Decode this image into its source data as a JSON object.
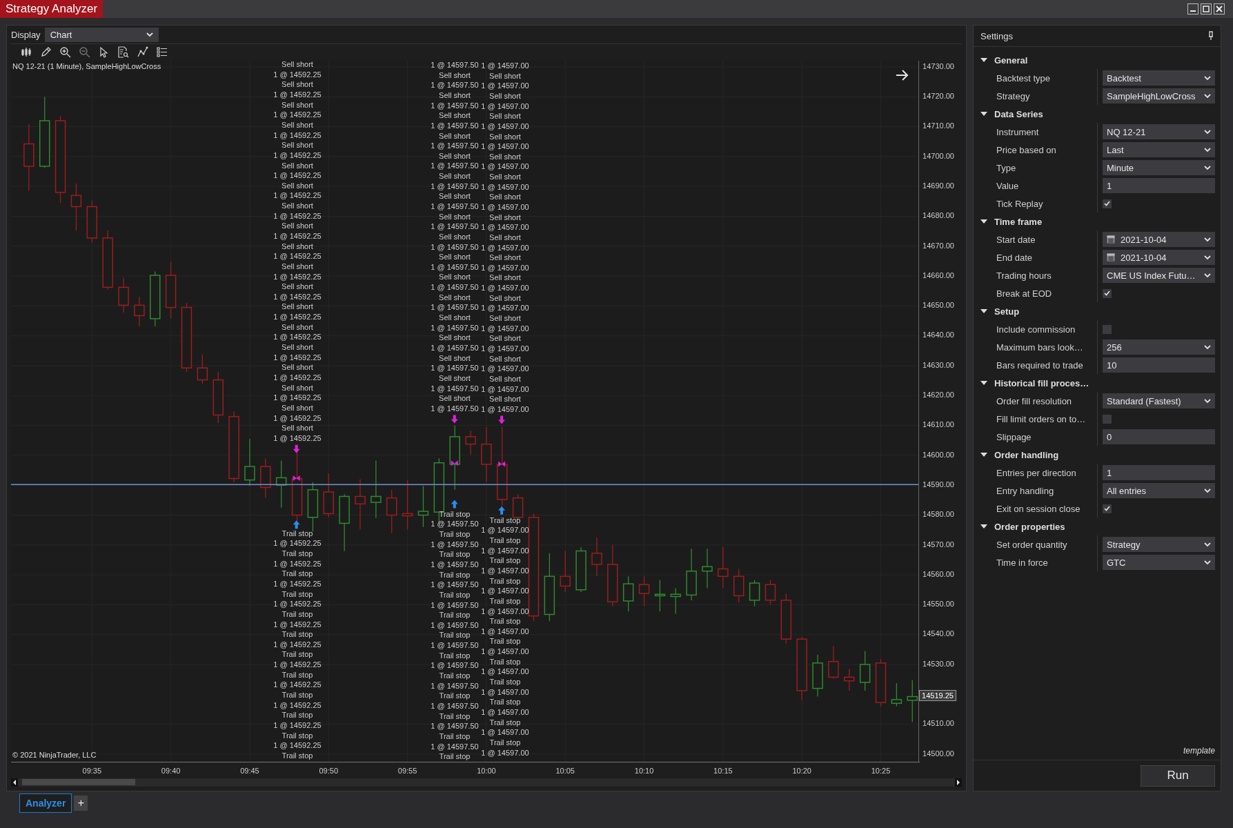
{
  "window": {
    "title": "Strategy Analyzer"
  },
  "display": {
    "label": "Display",
    "value": "Chart"
  },
  "chart": {
    "title": "NQ 12-21 (1 Minute), SampleHighLowCross",
    "copyright": "© 2021 NinjaTrader, LLC",
    "chart_data": {
      "type": "candlestick",
      "x": [
        571,
        572,
        573,
        574,
        575,
        576,
        577,
        578,
        579,
        580,
        581,
        582,
        583,
        584,
        585,
        586,
        587,
        588,
        589,
        590,
        591,
        592,
        593,
        594,
        595,
        596,
        597,
        598,
        599,
        600,
        601,
        602,
        603,
        604,
        605,
        606,
        607,
        608,
        609,
        610,
        611,
        612,
        613,
        614,
        615,
        616,
        617,
        618,
        619,
        620,
        621,
        622,
        623,
        624,
        625,
        626,
        627
      ],
      "xlim": [
        569.87,
        627.47
      ],
      "ylim": [
        14497.44,
        14732.08
      ],
      "grid": true,
      "ref_lines": [
        {
          "axis": "y",
          "value": 14590.25
        }
      ],
      "ohlc": [
        [
          14704.25,
          14710.75,
          14688.5,
          14696.75
        ],
        [
          14696.75,
          14720,
          14696.25,
          14712
        ],
        [
          14712,
          14713.5,
          14684.5,
          14688
        ],
        [
          14687,
          14691,
          14675.25,
          14683.25
        ],
        [
          14683.25,
          14685.25,
          14671.25,
          14672.75
        ],
        [
          14672.75,
          14675.25,
          14655.5,
          14656.25
        ],
        [
          14656.25,
          14659.5,
          14647.75,
          14650.25
        ],
        [
          14650.25,
          14653,
          14643.25,
          14646.75
        ],
        [
          14645.75,
          14661.5,
          14643.25,
          14660.25
        ],
        [
          14660.25,
          14664.75,
          14645.75,
          14649.5
        ],
        [
          14649.5,
          14651,
          14628,
          14629.25
        ],
        [
          14629.25,
          14633.75,
          14624,
          14625.25
        ],
        [
          14625.25,
          14628,
          14610.75,
          14613.5
        ],
        [
          14613,
          14614.75,
          14591,
          14592.25
        ],
        [
          14591.75,
          14605.5,
          14589.75,
          14596.25
        ],
        [
          14596.25,
          14599,
          14585.75,
          14589.25
        ],
        [
          14590,
          14598.25,
          14582.5,
          14592.5
        ],
        [
          14592.25,
          14601,
          14578,
          14580
        ],
        [
          14579.25,
          14591,
          14574.5,
          14588.5
        ],
        [
          14587.75,
          14594,
          14579.25,
          14580.5
        ],
        [
          14577.25,
          14587,
          14568,
          14586.25
        ],
        [
          14586.25,
          14592,
          14575.25,
          14583.75
        ],
        [
          14584.25,
          14598.25,
          14579,
          14586.25
        ],
        [
          14585.75,
          14588.5,
          14574,
          14580
        ],
        [
          14580.5,
          14591.75,
          14575.25,
          14579.75
        ],
        [
          14580,
          14589.75,
          14576,
          14581.25
        ],
        [
          14581,
          14599,
          14577.25,
          14597.5
        ],
        [
          14597,
          14610,
          14588.5,
          14606.25
        ],
        [
          14606.25,
          14608.25,
          14600.25,
          14603.75
        ],
        [
          14603.75,
          14609.5,
          14591,
          14597
        ],
        [
          14597,
          14609.5,
          14583.25,
          14585.25
        ],
        [
          14585.75,
          14587,
          14578.5,
          14579.25
        ],
        [
          14579.25,
          14580.5,
          14544.5,
          14546.25
        ],
        [
          14546.75,
          14567.25,
          14544.5,
          14559.5
        ],
        [
          14559.5,
          14568,
          14554.25,
          14556.25
        ],
        [
          14555,
          14569.25,
          14554.25,
          14568
        ],
        [
          14567.25,
          14572.5,
          14559.5,
          14563.5
        ],
        [
          14563.5,
          14570,
          14549.5,
          14551
        ],
        [
          14551.25,
          14559.5,
          14547.75,
          14557
        ],
        [
          14556.75,
          14559.5,
          14549.5,
          14553.75
        ],
        [
          14553,
          14558.25,
          14547.75,
          14553.5
        ],
        [
          14552.75,
          14555.5,
          14547,
          14553.5
        ],
        [
          14553.25,
          14568.75,
          14551.5,
          14561.25
        ],
        [
          14561.25,
          14568.75,
          14555.5,
          14562.75
        ],
        [
          14562,
          14569.25,
          14555.5,
          14559.5
        ],
        [
          14559.5,
          14562,
          14550.75,
          14553
        ],
        [
          14551.5,
          14558.25,
          14549.5,
          14557.25
        ],
        [
          14556.75,
          14558.25,
          14550,
          14551.5
        ],
        [
          14551.5,
          14553.75,
          14537,
          14538.5
        ],
        [
          14538.5,
          14539.25,
          14518,
          14521.25
        ],
        [
          14522,
          14533.25,
          14519.25,
          14530.5
        ],
        [
          14531,
          14536.25,
          14525.25,
          14525.75
        ],
        [
          14525.75,
          14528.5,
          14521.25,
          14524.5
        ],
        [
          14524,
          14534.5,
          14521.25,
          14530
        ],
        [
          14530.5,
          14531.75,
          14516,
          14517.25
        ],
        [
          14517,
          14523.75,
          14516,
          14518.25
        ],
        [
          14518,
          14524.75,
          14510.75,
          14519.25
        ]
      ],
      "xticks": [
        {
          "value": 575,
          "label": "09:35"
        },
        {
          "value": 580,
          "label": "09:40"
        },
        {
          "value": 585,
          "label": "09:45"
        },
        {
          "value": 590,
          "label": "09:50"
        },
        {
          "value": 595,
          "label": "09:55"
        },
        {
          "value": 600,
          "label": "10:00"
        },
        {
          "value": 605,
          "label": "10:05"
        },
        {
          "value": 610,
          "label": "10:10"
        },
        {
          "value": 615,
          "label": "10:15"
        },
        {
          "value": 620,
          "label": "10:20"
        },
        {
          "value": 625,
          "label": "10:25"
        }
      ],
      "yticks": [
        {
          "value": 14730,
          "label": "14730.00"
        },
        {
          "value": 14720,
          "label": "14720.00"
        },
        {
          "value": 14710,
          "label": "14710.00"
        },
        {
          "value": 14700,
          "label": "14700.00"
        },
        {
          "value": 14690,
          "label": "14690.00"
        },
        {
          "value": 14680,
          "label": "14680.00"
        },
        {
          "value": 14670,
          "label": "14670.00"
        },
        {
          "value": 14660,
          "label": "14660.00"
        },
        {
          "value": 14650,
          "label": "14650.00"
        },
        {
          "value": 14640,
          "label": "14640.00"
        },
        {
          "value": 14630,
          "label": "14630.00"
        },
        {
          "value": 14620,
          "label": "14620.00"
        },
        {
          "value": 14610,
          "label": "14610.00"
        },
        {
          "value": 14600,
          "label": "14600.00"
        },
        {
          "value": 14590,
          "label": "14590.00"
        },
        {
          "value": 14580,
          "label": "14580.00"
        },
        {
          "value": 14570,
          "label": "14570.00"
        },
        {
          "value": 14560,
          "label": "14560.00"
        },
        {
          "value": 14550,
          "label": "14550.00"
        },
        {
          "value": 14540,
          "label": "14540.00"
        },
        {
          "value": 14530,
          "label": "14530.00"
        },
        {
          "value": 14510,
          "label": "14510.00"
        },
        {
          "value": 14500,
          "label": "14500.00"
        }
      ]
    },
    "last_price": "14519.25",
    "annotations": [
      {
        "kind": "entry",
        "lines": [
          "Sell short",
          "1 @ 14592.25",
          "Sell short",
          "1 @ 14592.25",
          "Sell short",
          "1 @ 14592.25",
          "Sell short",
          "1 @ 14592.25",
          "Sell short",
          "1 @ 14592.25",
          "Sell short",
          "1 @ 14592.25",
          "Sell short",
          "1 @ 14592.25",
          "Sell short",
          "1 @ 14592.25",
          "Sell short",
          "1 @ 14592.25",
          "Sell short",
          "1 @ 14592.25",
          "Sell short",
          "1 @ 14592.25",
          "Sell short",
          "1 @ 14592.25",
          "Sell short",
          "1 @ 14592.25",
          "Sell short",
          "1 @ 14592.25",
          "Sell short",
          "1 @ 14592.25",
          "Sell short",
          "1 @ 14592.25",
          "Sell short",
          "1 @ 14592.25",
          "Sell short",
          "1 @ 14592.25",
          "Sell short",
          "1 @ 14592.25"
        ]
      },
      {
        "kind": "entry",
        "lines": [
          "1 @ 14597.50",
          "Sell short",
          "1 @ 14597.50",
          "Sell short",
          "1 @ 14597.50",
          "Sell short",
          "1 @ 14597.50",
          "Sell short",
          "1 @ 14597.50",
          "Sell short",
          "1 @ 14597.50",
          "Sell short",
          "1 @ 14597.50",
          "Sell short",
          "1 @ 14597.50",
          "Sell short",
          "1 @ 14597.50",
          "Sell short",
          "1 @ 14597.50",
          "Sell short",
          "1 @ 14597.50",
          "Sell short",
          "1 @ 14597.50",
          "Sell short",
          "1 @ 14597.50",
          "Sell short",
          "1 @ 14597.50",
          "Sell short",
          "1 @ 14597.50",
          "Sell short",
          "1 @ 14597.50",
          "Sell short",
          "1 @ 14597.50",
          "Sell short",
          "1 @ 14597.50"
        ]
      },
      {
        "kind": "entry",
        "lines": [
          "1 @ 14597.00",
          "Sell short",
          "1 @ 14597.00",
          "Sell short",
          "1 @ 14597.00",
          "Sell short",
          "1 @ 14597.00",
          "Sell short",
          "1 @ 14597.00",
          "Sell short",
          "1 @ 14597.00",
          "Sell short",
          "1 @ 14597.00",
          "Sell short",
          "1 @ 14597.00",
          "Sell short",
          "1 @ 14597.00",
          "Sell short",
          "1 @ 14597.00",
          "Sell short",
          "1 @ 14597.00",
          "Sell short",
          "1 @ 14597.00",
          "Sell short",
          "1 @ 14597.00",
          "Sell short",
          "1 @ 14597.00",
          "Sell short",
          "1 @ 14597.00",
          "Sell short",
          "1 @ 14597.00",
          "Sell short",
          "1 @ 14597.00",
          "Sell short",
          "1 @ 14597.00"
        ]
      },
      {
        "kind": "exit",
        "lines": [
          "Trail stop",
          "1 @ 14592.25",
          "Trail stop",
          "1 @ 14592.25",
          "Trail stop",
          "1 @ 14592.25",
          "Trail stop",
          "1 @ 14592.25",
          "Trail stop",
          "1 @ 14592.25",
          "Trail stop",
          "1 @ 14592.25",
          "Trail stop",
          "1 @ 14592.25",
          "Trail stop",
          "1 @ 14592.25",
          "Trail stop",
          "1 @ 14592.25",
          "Trail stop",
          "1 @ 14592.25",
          "Trail stop",
          "1 @ 14592.25",
          "Trail stop"
        ]
      },
      {
        "kind": "exit",
        "lines": [
          "Trail stop",
          "1 @ 14597.50",
          "Trail stop",
          "1 @ 14597.50",
          "Trail stop",
          "1 @ 14597.50",
          "Trail stop",
          "1 @ 14597.50",
          "Trail stop",
          "1 @ 14597.50",
          "Trail stop",
          "1 @ 14597.50",
          "Trail stop",
          "1 @ 14597.50",
          "Trail stop",
          "1 @ 14597.50",
          "Trail stop",
          "1 @ 14597.50",
          "Trail stop",
          "1 @ 14597.50",
          "Trail stop",
          "1 @ 14597.50",
          "Trail stop",
          "1 @ 14597.50",
          "Trail stop"
        ]
      },
      {
        "kind": "exit",
        "lines": [
          "Trail stop",
          "1 @ 14597.00",
          "Trail stop",
          "1 @ 14597.00",
          "Trail stop",
          "1 @ 14597.00",
          "Trail stop",
          "1 @ 14597.00",
          "Trail stop",
          "1 @ 14597.00",
          "Trail stop",
          "1 @ 14597.00",
          "Trail stop",
          "1 @ 14597.00",
          "Trail stop",
          "1 @ 14597.00",
          "Trail stop",
          "1 @ 14597.00",
          "Trail stop",
          "1 @ 14597.00",
          "Trail stop",
          "1 @ 14597.00",
          "Trail stop",
          "1 @ 14597.00"
        ]
      }
    ]
  },
  "settings": {
    "title": "Settings",
    "sections": [
      {
        "title": "General",
        "expanded": true,
        "rows": [
          {
            "label": "Backtest type",
            "kind": "dropdown",
            "value": "Backtest"
          },
          {
            "label": "Strategy",
            "kind": "dropdown",
            "value": "SampleHighLowCross"
          }
        ]
      },
      {
        "title": "Data Series",
        "expanded": true,
        "rows": [
          {
            "label": "Instrument",
            "kind": "dropdown",
            "value": "NQ 12-21"
          },
          {
            "label": "Price based on",
            "kind": "dropdown",
            "value": "Last"
          },
          {
            "label": "Type",
            "kind": "dropdown",
            "value": "Minute"
          },
          {
            "label": "Value",
            "kind": "text",
            "value": "1"
          },
          {
            "label": "Tick Replay",
            "kind": "checkbox",
            "checked": true
          }
        ]
      },
      {
        "title": "Time frame",
        "expanded": true,
        "rows": [
          {
            "label": "Start date",
            "kind": "date",
            "value": "2021-10-04"
          },
          {
            "label": "End date",
            "kind": "date",
            "value": "2021-10-04"
          },
          {
            "label": "Trading hours",
            "kind": "dropdown",
            "value": "CME US Index Futu…"
          },
          {
            "label": "Break at EOD",
            "kind": "checkbox",
            "checked": true
          }
        ]
      },
      {
        "title": "Setup",
        "expanded": true,
        "rows": [
          {
            "label": "Include commission",
            "kind": "checkbox",
            "checked": false
          },
          {
            "label": "Maximum bars look…",
            "kind": "dropdown",
            "value": "256"
          },
          {
            "label": "Bars required to trade",
            "kind": "text",
            "value": "10"
          }
        ]
      },
      {
        "title": "Historical fill proces…",
        "expanded": true,
        "rows": [
          {
            "label": "Order fill resolution",
            "kind": "dropdown",
            "value": "Standard (Fastest)"
          },
          {
            "label": "Fill limit orders on to…",
            "kind": "checkbox",
            "checked": false
          },
          {
            "label": "Slippage",
            "kind": "text",
            "value": "0"
          }
        ]
      },
      {
        "title": "Order handling",
        "expanded": true,
        "rows": [
          {
            "label": "Entries per direction",
            "kind": "text",
            "value": "1"
          },
          {
            "label": "Entry handling",
            "kind": "dropdown",
            "value": "All entries"
          },
          {
            "label": "Exit on session close",
            "kind": "checkbox",
            "checked": true
          }
        ]
      },
      {
        "title": "Order properties",
        "expanded": true,
        "rows": [
          {
            "label": "Set order quantity",
            "kind": "dropdown",
            "value": "Strategy"
          },
          {
            "label": "Time in force",
            "kind": "dropdown",
            "value": "GTC"
          }
        ]
      }
    ],
    "template_label": "template",
    "run_button": "Run"
  },
  "tabs": [
    {
      "label": "Analyzer",
      "selected": true
    }
  ],
  "add_tab": "+"
}
